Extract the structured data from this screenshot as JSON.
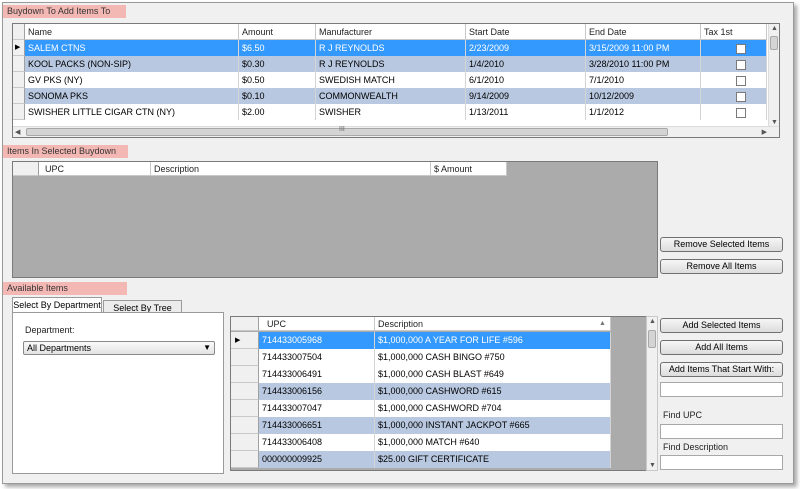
{
  "sections": {
    "buydown_header": "Buydown To Add Items To",
    "items_header": "Items In Selected Buydown",
    "available_header": "Available Items"
  },
  "buydown_grid": {
    "columns": [
      "Name",
      "Amount",
      "Manufacturer",
      "Start Date",
      "End Date",
      "Tax 1st"
    ],
    "rows": [
      {
        "name": "SALEM CTNS",
        "amount": "$6.50",
        "manufacturer": "R J REYNOLDS",
        "start": "2/23/2009",
        "end": "3/15/2009 11:00 PM",
        "style": "sel"
      },
      {
        "name": "KOOL PACKS (NON-SIP)",
        "amount": "$0.30",
        "manufacturer": "R J REYNOLDS",
        "start": "1/4/2010",
        "end": "3/28/2010 11:00 PM",
        "style": "alt"
      },
      {
        "name": "GV PKS (NY)",
        "amount": "$0.50",
        "manufacturer": "SWEDISH MATCH",
        "start": "6/1/2010",
        "end": "7/1/2010",
        "style": "white"
      },
      {
        "name": "SONOMA PKS",
        "amount": "$0.10",
        "manufacturer": "COMMONWEALTH",
        "start": "9/14/2009",
        "end": "10/12/2009",
        "style": "alt"
      },
      {
        "name": "SWISHER LITTLE CIGAR CTN (NY)",
        "amount": "$2.00",
        "manufacturer": "SWISHER",
        "start": "1/13/2011",
        "end": "1/1/2012",
        "style": "white"
      }
    ],
    "hscroll_grip": "III"
  },
  "items_grid": {
    "columns": [
      "UPC",
      "Description",
      "$ Amount"
    ]
  },
  "buttons": {
    "remove_selected": "Remove Selected Items",
    "remove_all": "Remove All Items",
    "add_selected": "Add Selected Items",
    "add_all": "Add All Items",
    "add_start_with": "Add Items That Start With:"
  },
  "tabs": {
    "department": "Select By Department",
    "tree_view": "Select By Tree View"
  },
  "department": {
    "label": "Department:",
    "value": "All Departments"
  },
  "available_grid": {
    "columns": [
      "UPC",
      "Description"
    ],
    "rows": [
      {
        "upc": "714433005968",
        "description": "$1,000,000 A YEAR FOR LIFE #596",
        "style": "sel"
      },
      {
        "upc": "714433007504",
        "description": "$1,000,000 CASH BINGO #750",
        "style": "white"
      },
      {
        "upc": "714433006491",
        "description": "$1,000,000 CASH BLAST #649",
        "style": "white"
      },
      {
        "upc": "714433006156",
        "description": "$1,000,000 CASHWORD #615",
        "style": "alt"
      },
      {
        "upc": "714433007047",
        "description": "$1,000,000 CASHWORD #704",
        "style": "white"
      },
      {
        "upc": "714433006651",
        "description": "$1,000,000 INSTANT JACKPOT #665",
        "style": "alt"
      },
      {
        "upc": "714433006408",
        "description": "$1,000,000 MATCH #640",
        "style": "white"
      },
      {
        "upc": "000000009925",
        "description": "$25.00 GIFT CERTIFICATE",
        "style": "alt"
      }
    ]
  },
  "find": {
    "upc_label": "Find UPC",
    "description_label": "Find Description"
  },
  "icons": {
    "row_pointer": "triangle-right",
    "sort": "triangle-up",
    "dropdown": "triangle-down"
  },
  "colors": {
    "selection": "#3399ff",
    "alternate_row": "#b8c8e0",
    "section_header": "#f4b8b4"
  }
}
